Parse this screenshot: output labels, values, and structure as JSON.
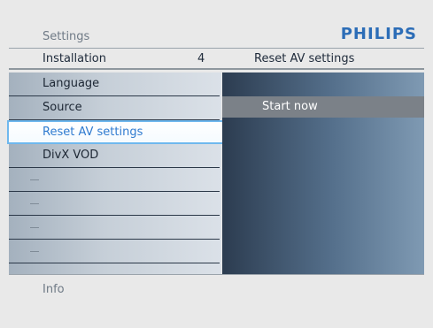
{
  "header": {
    "title": "Settings",
    "brand": "PHILIPS"
  },
  "path": {
    "left": "Installation",
    "count": "4",
    "right": "Reset AV settings"
  },
  "menu": {
    "items": [
      {
        "label": "Language"
      },
      {
        "label": "Source"
      },
      {
        "label": "Reset AV settings"
      },
      {
        "label": "DivX VOD"
      },
      {
        "label": ""
      },
      {
        "label": ""
      },
      {
        "label": ""
      },
      {
        "label": ""
      }
    ],
    "selected_label": "Reset AV settings"
  },
  "options": {
    "items": [
      {
        "label": "Start now"
      }
    ]
  },
  "footer": {
    "info": "Info"
  },
  "colors": {
    "brand": "#2c6db7",
    "selection_border": "#6fb8ee",
    "selection_text": "#2f7bd0"
  }
}
